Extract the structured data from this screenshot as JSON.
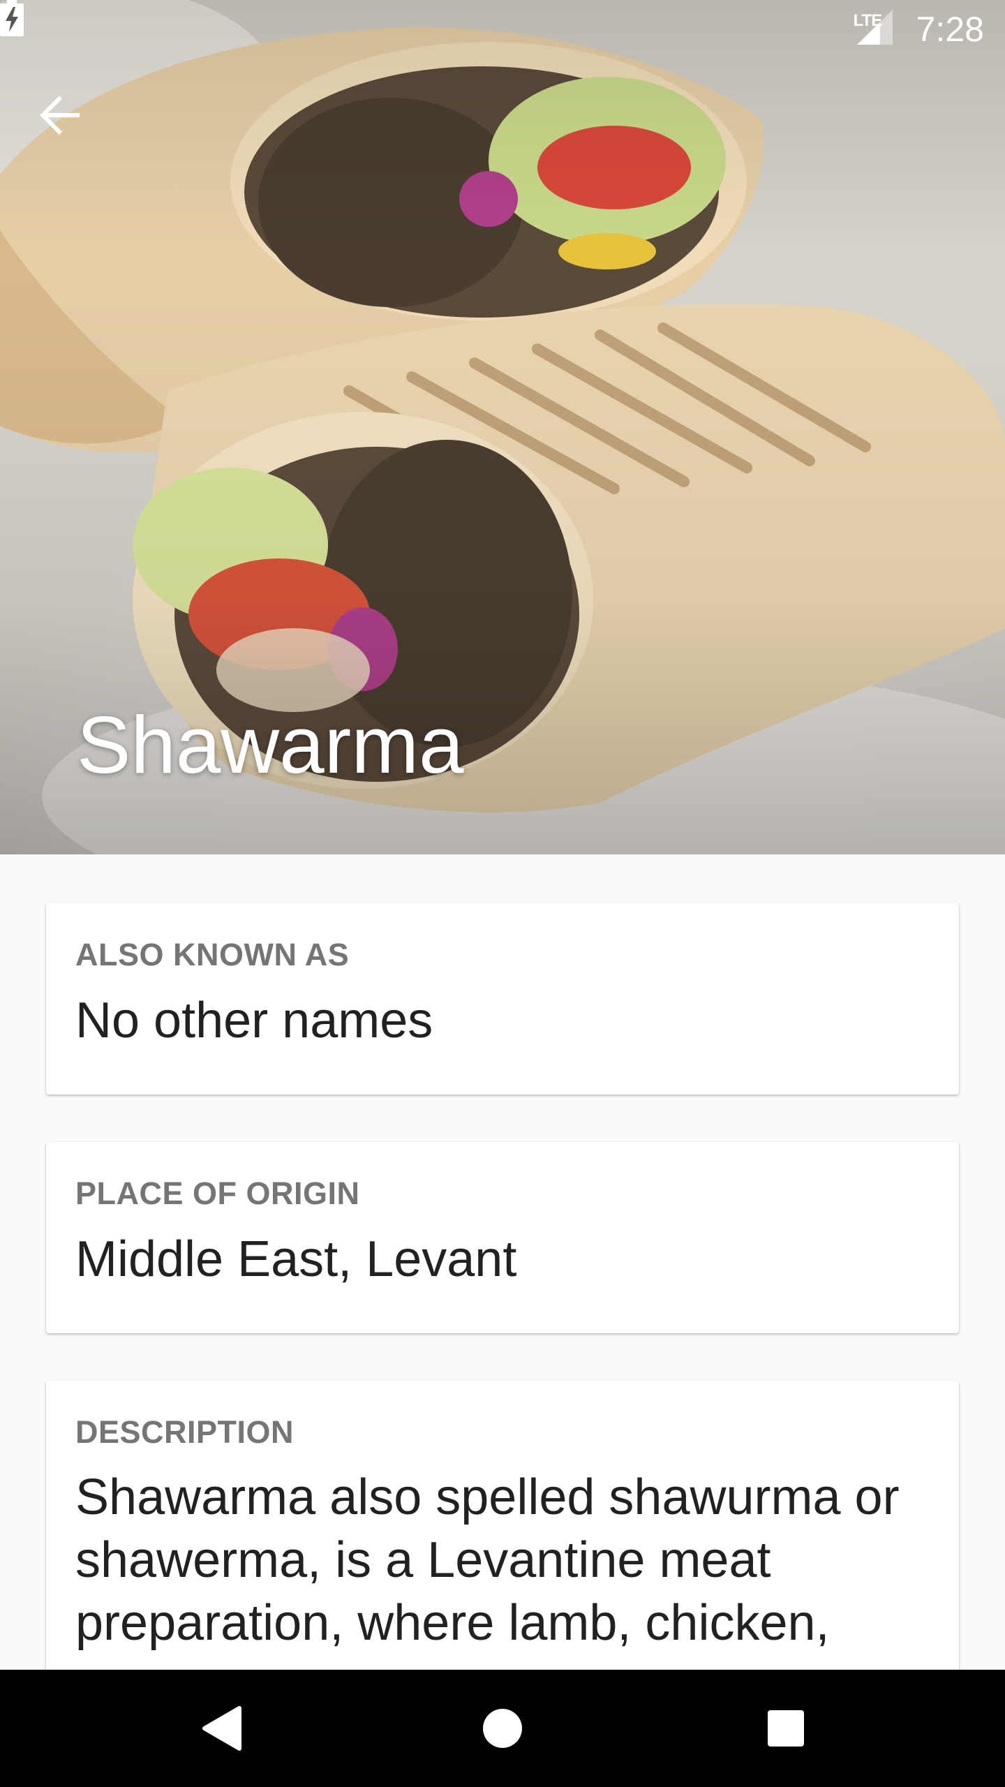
{
  "status_bar": {
    "network": "LTE",
    "time": "7:28"
  },
  "header": {
    "title": "Shawarma",
    "back_icon": "arrow-back-icon"
  },
  "cards": {
    "also_known_as": {
      "label": "ALSO KNOWN AS",
      "value": "No other names"
    },
    "place_of_origin": {
      "label": "PLACE OF ORIGIN",
      "value": "Middle East, Levant"
    },
    "description": {
      "label": "DESCRIPTION",
      "value": "Shawarma also spelled shawurma or shawerma, is a Levantine meat preparation, where lamb, chicken,"
    }
  },
  "nav_bar": {
    "back_icon": "triangle-back-icon",
    "home_icon": "circle-home-icon",
    "recents_icon": "square-recents-icon"
  },
  "colors": {
    "background": "#fafafa",
    "card": "#ffffff",
    "label": "#757575",
    "value": "#212121",
    "nav_bar": "#000000"
  }
}
